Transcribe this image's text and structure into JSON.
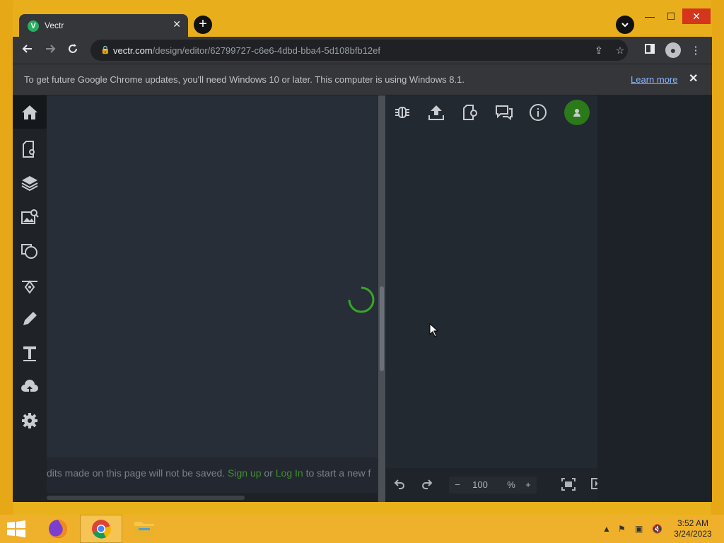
{
  "browser": {
    "tab_title": "Vectr",
    "tab_favicon_letter": "V",
    "url_host": "vectr.com",
    "url_path": "/design/editor/62799727-c6e6-4dbd-bba4-5d108bfb12ef",
    "window_buttons": {
      "minimize": "—",
      "maximize": "☐",
      "close": "✕"
    }
  },
  "infobar": {
    "message": "To get future Google Chrome updates, you'll need Windows 10 or later. This computer is using Windows 8.1.",
    "learn_more": "Learn more"
  },
  "sidebar": {
    "items": [
      {
        "name": "home",
        "icon": "home-icon"
      },
      {
        "name": "page-settings",
        "icon": "page-settings-icon"
      },
      {
        "name": "layers",
        "icon": "layers-icon"
      },
      {
        "name": "image-search",
        "icon": "image-search-icon"
      },
      {
        "name": "shapes",
        "icon": "shapes-icon"
      },
      {
        "name": "pen",
        "icon": "pen-tool-icon"
      },
      {
        "name": "pencil",
        "icon": "pencil-icon"
      },
      {
        "name": "text",
        "icon": "text-icon"
      },
      {
        "name": "upload",
        "icon": "cloud-upload-icon"
      },
      {
        "name": "settings",
        "icon": "gear-icon"
      }
    ]
  },
  "canvas": {
    "loading": true,
    "footer_prefix": "dits made on this page will not be saved.",
    "footer_signup": "Sign up",
    "footer_or": "or",
    "footer_login": "Log In",
    "footer_suffix": "to start a new f"
  },
  "right_panel": {
    "toolbar_icons": [
      "debug-icon",
      "export-icon",
      "new-page-icon",
      "comments-icon",
      "info-icon",
      "user-icon"
    ],
    "zoom_value": "100",
    "zoom_unit": "%",
    "zoom_minus": "−",
    "zoom_plus": "+"
  },
  "taskbar": {
    "clock_time": "3:52 AM",
    "clock_date": "3/24/2023",
    "apps": [
      "firefox",
      "chrome",
      "file-explorer"
    ]
  },
  "colors": {
    "accent_green": "#3f8f2f",
    "avatar_green": "#2a7a1a",
    "desktop": "#e9b21c"
  }
}
